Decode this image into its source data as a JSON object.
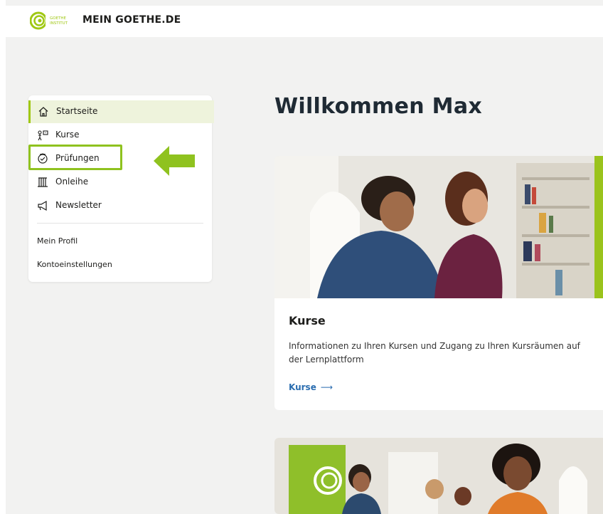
{
  "header": {
    "logo_text": "GOETHE INSTITUT",
    "site_title": "MEIN GOETHE.DE"
  },
  "sidebar": {
    "nav": [
      {
        "label": "Startseite",
        "icon": "home-icon",
        "active": true
      },
      {
        "label": "Kurse",
        "icon": "courses-icon",
        "active": false
      },
      {
        "label": "Prüfungen",
        "icon": "exam-icon",
        "active": false
      },
      {
        "label": "Onleihe",
        "icon": "library-icon",
        "active": false
      },
      {
        "label": "Newsletter",
        "icon": "megaphone-icon",
        "active": false
      }
    ],
    "links": [
      {
        "label": "Mein Profil"
      },
      {
        "label": "Kontoeinstellungen"
      }
    ]
  },
  "main": {
    "welcome": "Willkommen Max",
    "cards": [
      {
        "title": "Kurse",
        "description": "Informationen zu Ihren Kursen und Zugang zu Ihren Kursräumen auf der Lernplattform",
        "link_label": "Kurse",
        "link_arrow": "⟶"
      }
    ]
  },
  "colors": {
    "accent": "#a0c814",
    "highlight": "#8fc21f",
    "link": "#2a6db0",
    "background": "#f2f2f1"
  }
}
